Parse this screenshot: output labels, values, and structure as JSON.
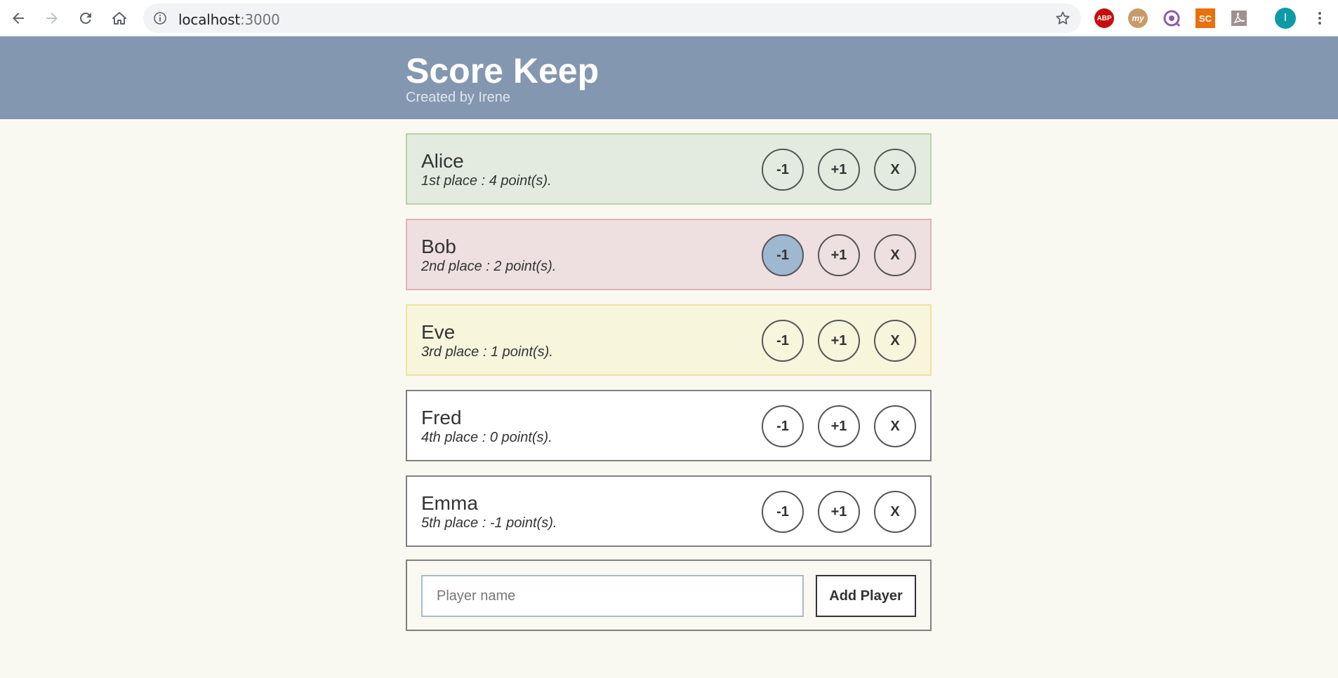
{
  "browser": {
    "url_host": "localhost",
    "url_port": ":3000",
    "profile_initial": "I",
    "extensions": [
      "ABP",
      "my",
      "SC"
    ]
  },
  "header": {
    "title": "Score Keep",
    "subtitle": "Created by Irene",
    "background": "#8497b0"
  },
  "players": [
    {
      "name": "Alice",
      "stats": "1st place : 4 point(s).",
      "bg": "#e3ebe0",
      "border": "#b7d3a9"
    },
    {
      "name": "Bob",
      "stats": "2nd place : 2 point(s).",
      "bg": "#eedfe0",
      "border": "#dfb3b6"
    },
    {
      "name": "Eve",
      "stats": "3rd place : 1 point(s).",
      "bg": "#f7f5dc",
      "border": "#ebe39c"
    },
    {
      "name": "Fred",
      "stats": "4th place : 0 point(s).",
      "bg": "#ffffff",
      "border": "#808080"
    },
    {
      "name": "Emma",
      "stats": "5th place : -1 point(s).",
      "bg": "#ffffff",
      "border": "#808080"
    }
  ],
  "buttons": {
    "minus": "-1",
    "plus": "+1",
    "remove": "X"
  },
  "form": {
    "placeholder": "Player name",
    "value": "",
    "submit_label": "Add Player"
  }
}
